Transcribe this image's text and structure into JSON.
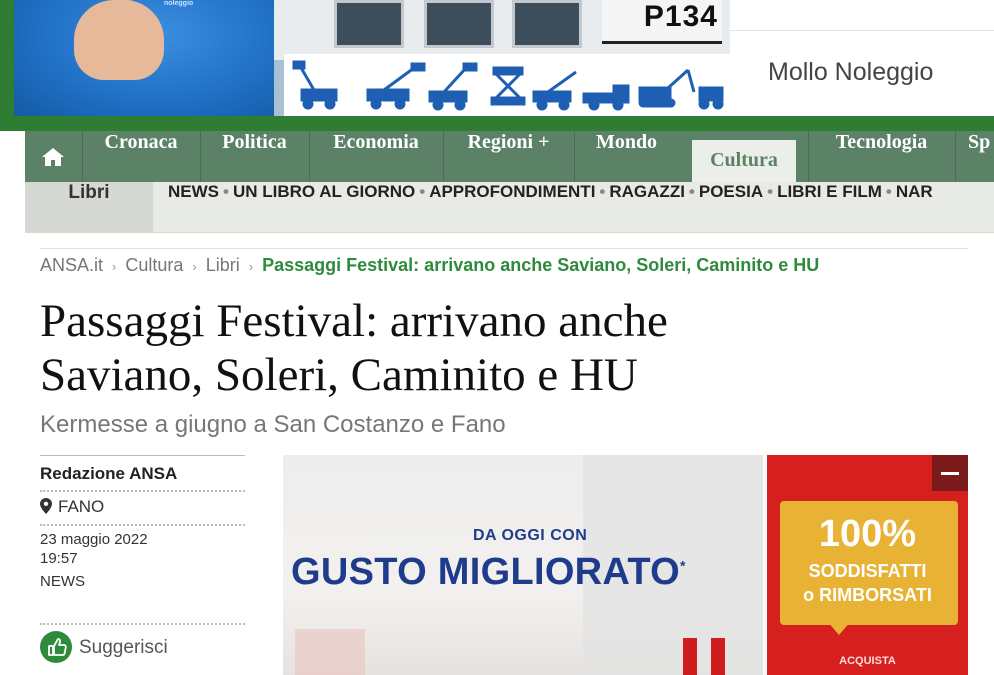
{
  "top_ad": {
    "sign_text": "P134",
    "shirt_logo": "noleggio",
    "brand": "Mollo Noleggio"
  },
  "nav": {
    "home_icon": "home-icon",
    "items": [
      {
        "label": "Cronaca"
      },
      {
        "label": "Politica"
      },
      {
        "label": "Economia"
      },
      {
        "label": "Regioni +"
      },
      {
        "label": "Mondo"
      },
      {
        "label": "Cultura",
        "active": true
      },
      {
        "label": "Tecnologia"
      },
      {
        "label": "Sp"
      }
    ],
    "accent_color": "#5b8266"
  },
  "subnav": {
    "section": "Libri",
    "links": [
      "NEWS",
      "UN LIBRO AL GIORNO",
      "APPROFONDIMENTI",
      "RAGAZZI",
      "POESIA",
      "LIBRI E FILM",
      "NAR"
    ]
  },
  "breadcrumb": {
    "items": [
      "ANSA.it",
      "Cultura",
      "Libri"
    ],
    "current": "Passaggi Festival: arrivano anche Saviano, Soleri, Caminito e HU",
    "separator": "›"
  },
  "article": {
    "title_line1": "Passaggi Festival: arrivano anche",
    "title_line2": "Saviano, Soleri, Caminito e HU",
    "subtitle": "Kermesse a giugno a San Costanzo e Fano",
    "author": "Redazione ANSA",
    "place": "FANO",
    "date": "23 maggio 2022",
    "time": "19:57",
    "category": "NEWS",
    "suggest_label": "Suggerisci",
    "link_color": "#2e8b3c"
  },
  "inline_ad": {
    "small_text": "DA OGGI CON",
    "big_text": "GUSTO MIGLIORATO",
    "asterisk": "*",
    "badge_pct": "100%",
    "badge_line1": "SODDISFATTI",
    "badge_line2": "o RIMBORSATI",
    "badge_line3": "ACQUISTA"
  }
}
